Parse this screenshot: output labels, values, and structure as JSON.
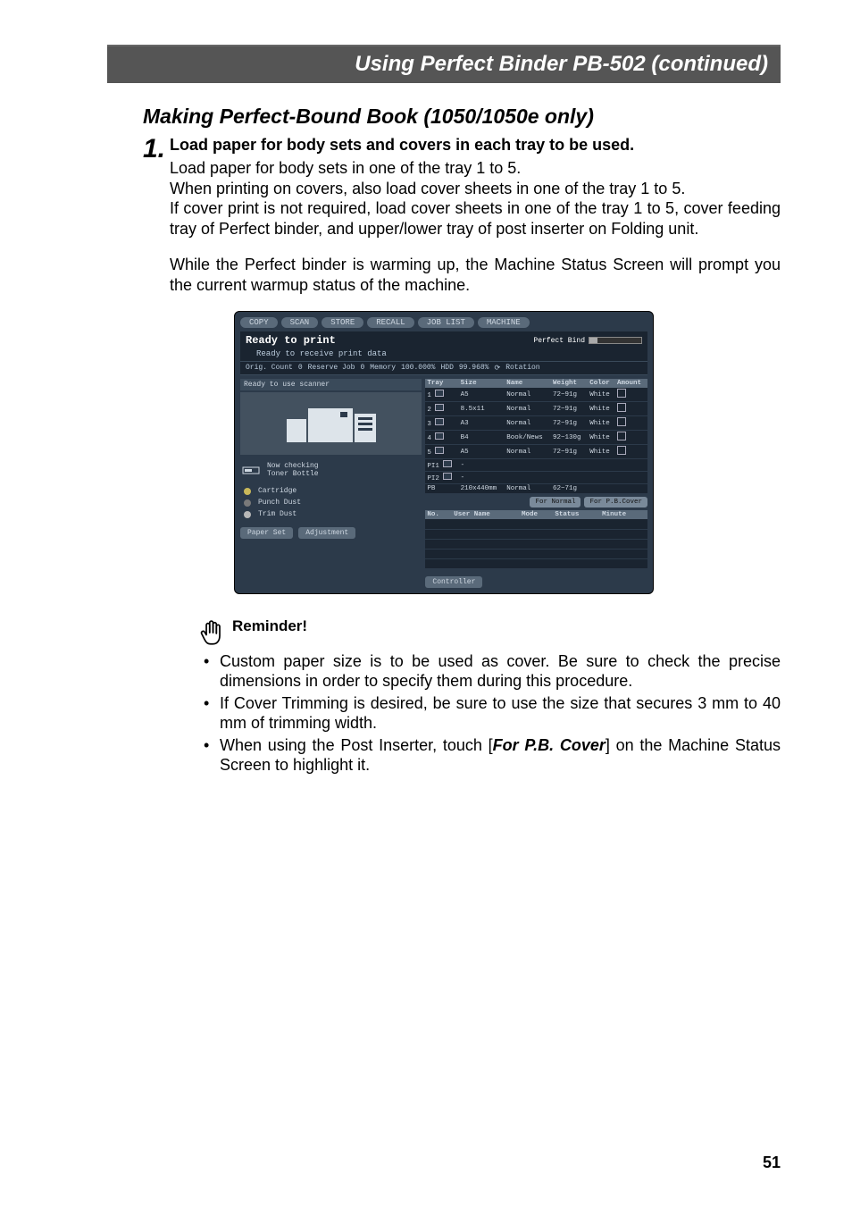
{
  "header": {
    "title": "Using Perfect Binder PB-502 (continued)"
  },
  "section_title": "Making Perfect-Bound Book (1050/1050e only)",
  "step1": {
    "num": "1.",
    "heading": "Load paper for body sets and covers in each tray to be used.",
    "p1": "Load paper for body sets in one of the tray 1 to 5.",
    "p2": "When printing on covers, also load cover sheets in one of the tray 1 to 5.",
    "p3": "If cover print is not required, load cover sheets in one of the tray 1 to 5, cover feeding tray of Perfect binder, and upper/lower tray of post inserter on Folding unit.",
    "p4": "While the Perfect binder is warming up, the Machine Status Screen will prompt you the current warmup status of the machine."
  },
  "screenshot": {
    "tabs": [
      "COPY",
      "SCAN",
      "STORE",
      "RECALL",
      "JOB LIST",
      "MACHINE"
    ],
    "status_text": "Ready to print",
    "perfect_bind_label": "Perfect Bind",
    "substatus": "Ready to receive print data",
    "bar": {
      "orig_count_label": "Orig. Count",
      "orig_count_val": "0",
      "reserve_label": "Reserve Job",
      "reserve_val": "0",
      "memory_label": "Memory",
      "memory_val": "100.000%",
      "hdd_label": "HDD",
      "hdd_val": "99.968%",
      "rotation_label": "Rotation"
    },
    "scanner_label": "Ready to use scanner",
    "toner_line1": "Now checking",
    "toner_line2": "Toner Bottle",
    "lamps": [
      {
        "label": "Cartridge"
      },
      {
        "label": "Punch Dust"
      },
      {
        "label": "Trim Dust"
      }
    ],
    "buttons": {
      "paper": "Paper Set",
      "adjust": "Adjustment",
      "controller": "Controller"
    },
    "tray_headers": [
      "Tray",
      "Size",
      "Name",
      "Weight",
      "Color",
      "Amount"
    ],
    "trays": [
      {
        "n": "1",
        "size": "A5",
        "name": "Normal",
        "weight": "72~91g",
        "color": "White"
      },
      {
        "n": "2",
        "size": "8.5x11",
        "name": "Normal",
        "weight": "72~91g",
        "color": "White"
      },
      {
        "n": "3",
        "size": "A3",
        "name": "Normal",
        "weight": "72~91g",
        "color": "White"
      },
      {
        "n": "4",
        "size": "B4",
        "name": "Book/News",
        "weight": "92~130g",
        "color": "White"
      },
      {
        "n": "5",
        "size": "A5",
        "name": "Normal",
        "weight": "72~91g",
        "color": "White"
      }
    ],
    "pi1_label": "PI1",
    "pi2_label": "PI2",
    "pb_row": {
      "n": "PB",
      "size": "210x440mm",
      "name": "Normal",
      "weight": "62~71g"
    },
    "mid_buttons": {
      "normal": "For Normal",
      "cover": "For P.B.Cover"
    },
    "job_headers": [
      "No.",
      "User Name",
      "Mode",
      "Status",
      "Minute"
    ]
  },
  "reminder": {
    "label": "Reminder!",
    "b1": "Custom paper size is to be used as cover. Be sure to check the precise dimensions in order to specify them during this procedure.",
    "b2": "If Cover Trimming is desired, be sure to use the size that secures 3 mm to 40 mm of trimming width.",
    "b3_a": "When using the Post Inserter, touch [",
    "b3_b": "For P.B. Cover",
    "b3_c": "] on the Machine Status Screen to highlight it."
  },
  "page_number": "51"
}
